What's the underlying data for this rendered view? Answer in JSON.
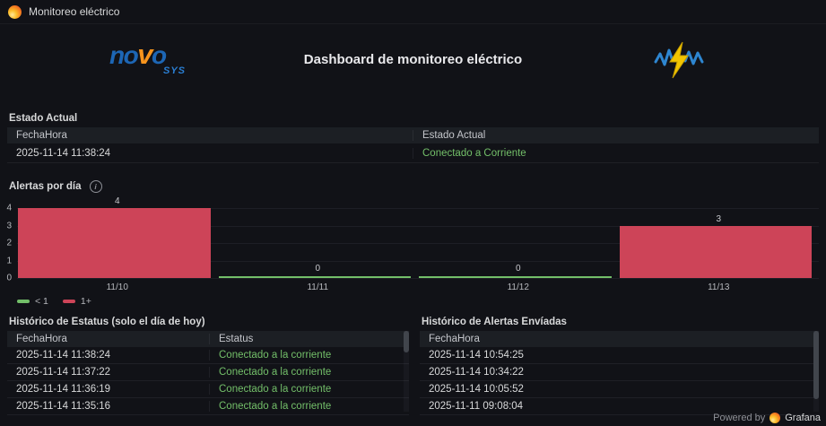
{
  "navbar": {
    "title": "Monitoreo eléctrico"
  },
  "header": {
    "logo": {
      "p1": "no",
      "p2": "v",
      "p3": "o",
      "sub": "SYS"
    },
    "title": "Dashboard de monitoreo eléctrico"
  },
  "estado_actual": {
    "title": "Estado Actual",
    "columns": {
      "0": "FechaHora",
      "1": "Estado Actual"
    },
    "row": {
      "fecha": "2025-11-14 11:38:24",
      "estado": "Conectado a Corriente"
    }
  },
  "chart_data": {
    "type": "bar",
    "title": "Alertas por día",
    "categories": [
      "11/10",
      "11/11",
      "11/12",
      "11/13"
    ],
    "values": [
      4,
      0,
      0,
      3
    ],
    "value_labels": [
      "4",
      "0",
      "0",
      "3"
    ],
    "bar_colors": [
      "#cd4458",
      "#73bf69",
      "#73bf69",
      "#cd4458"
    ],
    "ylim": [
      0,
      4
    ],
    "yticks": [
      0,
      1,
      2,
      3,
      4
    ],
    "xlabel": "",
    "ylabel": "",
    "grid": true,
    "legend_position": "bottom-left",
    "legend": [
      {
        "label": "< 1",
        "color": "#73bf69"
      },
      {
        "label": "1+",
        "color": "#cd4458"
      }
    ]
  },
  "historico_estatus": {
    "title": "Histórico de Estatus (solo el día de hoy)",
    "columns": {
      "0": "FechaHora",
      "1": "Estatus"
    },
    "rows": [
      {
        "fecha": "2025-11-14 11:38:24",
        "estatus": "Conectado a la corriente"
      },
      {
        "fecha": "2025-11-14 11:37:22",
        "estatus": "Conectado a la corriente"
      },
      {
        "fecha": "2025-11-14 11:36:19",
        "estatus": "Conectado a la corriente"
      },
      {
        "fecha": "2025-11-14 11:35:16",
        "estatus": "Conectado a la corriente"
      }
    ]
  },
  "historico_alertas": {
    "title": "Histórico de Alertas Envíadas",
    "columns": {
      "0": "FechaHora"
    },
    "rows": [
      "2025-11-14 10:54:25",
      "2025-11-14 10:34:22",
      "2025-11-14 10:05:52",
      "2025-11-11 09:08:04"
    ]
  },
  "footer": {
    "powered_by": "Powered by",
    "brand": "Grafana"
  },
  "colors": {
    "background": "#111217",
    "red": "#cd4458",
    "green": "#73bf69",
    "yellow_bolt": "#f2c500",
    "blue_wave": "#2e86d1",
    "novo_blue": "#1d66b5",
    "novo_orange": "#f7941d"
  }
}
